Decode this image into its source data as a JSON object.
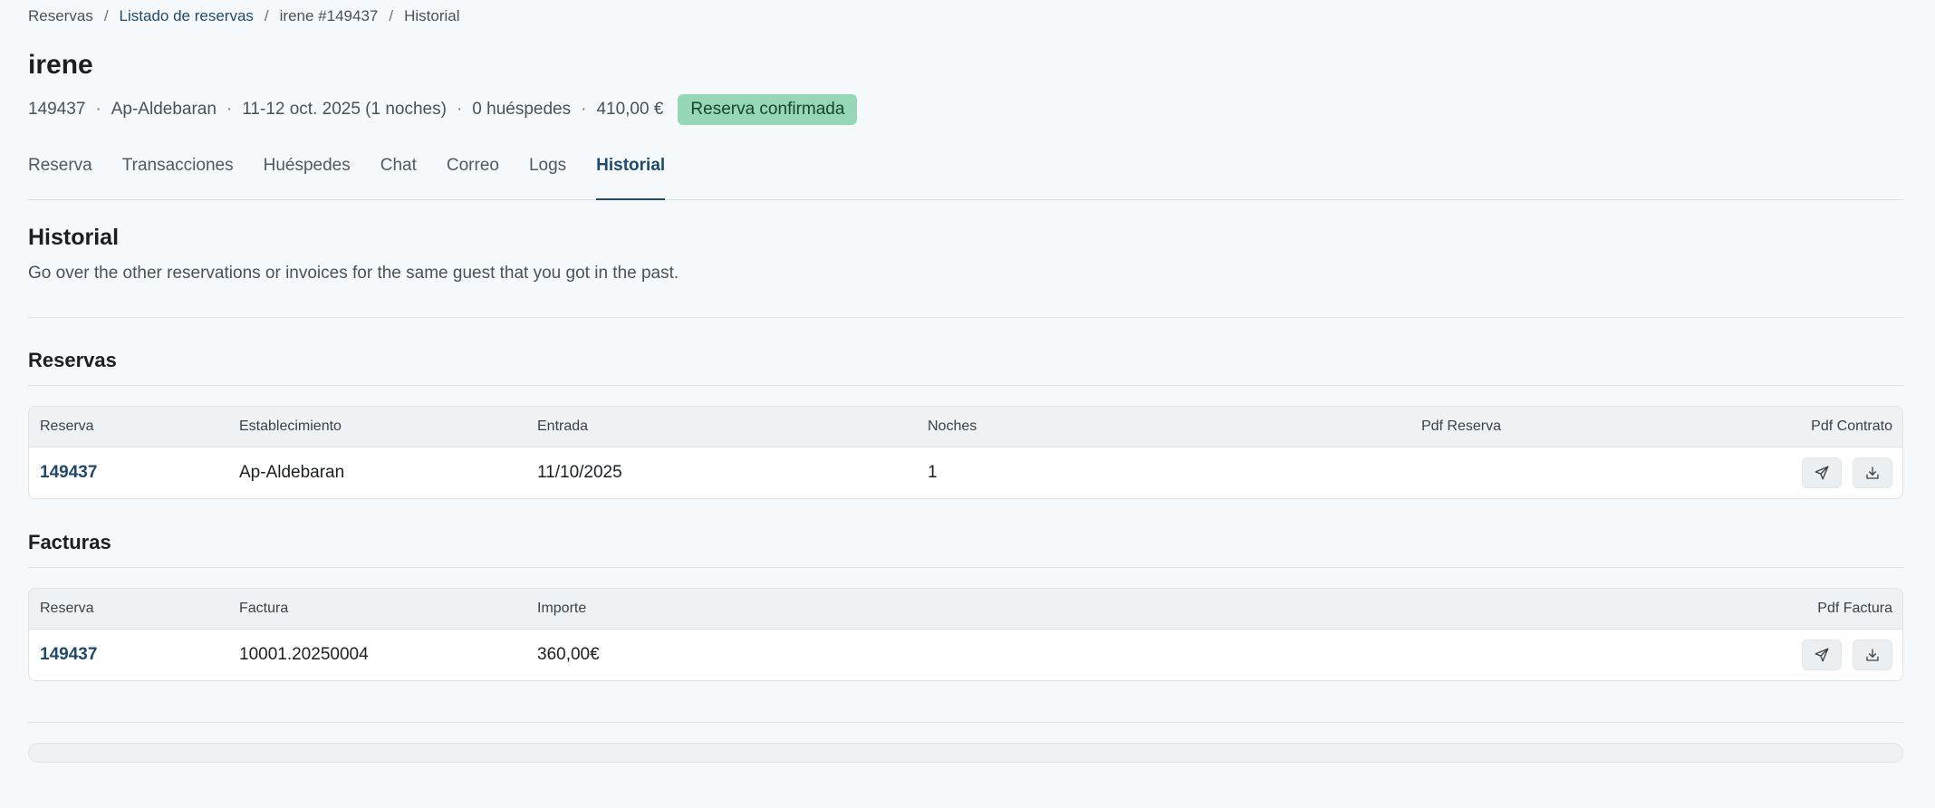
{
  "breadcrumb": {
    "items": [
      "Reservas",
      "Listado de reservas",
      "irene #149437",
      "Historial"
    ],
    "separator": "/"
  },
  "page_title": "irene",
  "meta": {
    "id": "149437",
    "property": "Ap-Aldebaran",
    "dates": "11-12 oct. 2025 (1 noches)",
    "guests": "0 huéspedes",
    "amount": "410,00 €",
    "dot": "·",
    "status": "Reserva confirmada",
    "status_color": "#96d8b5"
  },
  "tabs": [
    {
      "label": "Reserva"
    },
    {
      "label": "Transacciones"
    },
    {
      "label": "Huéspedes"
    },
    {
      "label": "Chat"
    },
    {
      "label": "Correo"
    },
    {
      "label": "Logs"
    },
    {
      "label": "Historial",
      "active": true
    }
  ],
  "section": {
    "title": "Historial",
    "description": "Go over the other reservations or invoices for the same guest that you got in the past."
  },
  "reservas": {
    "title": "Reservas",
    "columns": [
      "Reserva",
      "Establecimiento",
      "Entrada",
      "Noches",
      "Pdf Reserva",
      "Pdf Contrato"
    ],
    "rows": [
      {
        "reserva": "149437",
        "establecimiento": "Ap-Aldebaran",
        "entrada": "11/10/2025",
        "noches": "1"
      }
    ]
  },
  "facturas": {
    "title": "Facturas",
    "columns": [
      "Reserva",
      "Factura",
      "Importe",
      "Pdf Factura"
    ],
    "rows": [
      {
        "reserva": "149437",
        "factura": "10001.20250004",
        "importe": "360,00€"
      }
    ]
  },
  "icons": {
    "send": "send-icon",
    "download": "download-icon"
  },
  "colors": {
    "accent": "#1f4a6b",
    "background": "#f5f9fc"
  }
}
